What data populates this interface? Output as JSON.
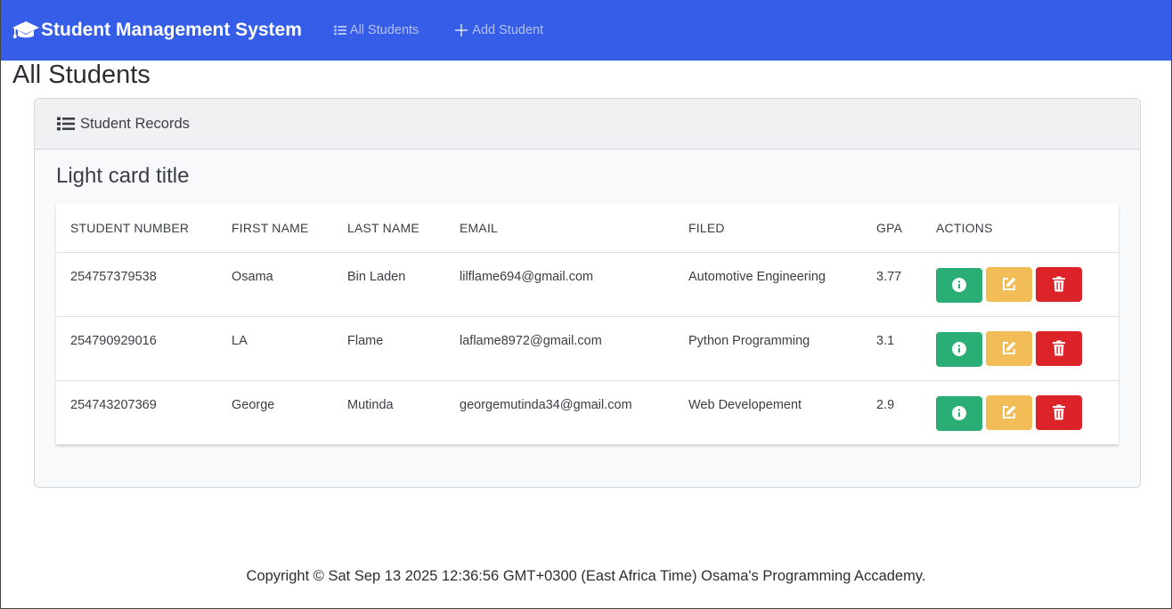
{
  "navbar": {
    "brand": "Student Management System",
    "brand_icon": "graduation-cap-icon",
    "links": [
      {
        "label": "All Students",
        "icon": "list-icon"
      },
      {
        "label": "Add Student",
        "icon": "plus-icon"
      }
    ],
    "bg_color": "#355de8"
  },
  "page": {
    "title": "All Students"
  },
  "card": {
    "header": "Student Records",
    "header_icon": "list-icon",
    "title": "Light card title"
  },
  "table": {
    "columns": [
      "STUDENT NUMBER",
      "FIRST NAME",
      "LAST NAME",
      "EMAIL",
      "FILED",
      "GPA",
      "ACTIONS"
    ],
    "rows": [
      {
        "number": "254757379538",
        "first": "Osama",
        "last": "Bin Laden",
        "email": "lilflame694@gmail.com",
        "field": "Automotive Engineering",
        "gpa": "3.77"
      },
      {
        "number": "254790929016",
        "first": "LA",
        "last": "Flame",
        "email": "laflame8972@gmail.com",
        "field": "Python Programming",
        "gpa": "3.1"
      },
      {
        "number": "254743207369",
        "first": "George",
        "last": "Mutinda",
        "email": "georgemutinda34@gmail.com",
        "field": "Web Developement",
        "gpa": "2.9"
      }
    ],
    "action_icons": [
      "info-icon",
      "edit-icon",
      "trash-icon"
    ],
    "action_colors": {
      "info": "#2bae76",
      "edit": "#f2bc57",
      "delete": "#dc2329"
    }
  },
  "footer": {
    "text": "Copyright © Sat Sep 13 2025 12:36:56 GMT+0300 (East Africa Time) Osama's Programming Accademy."
  }
}
